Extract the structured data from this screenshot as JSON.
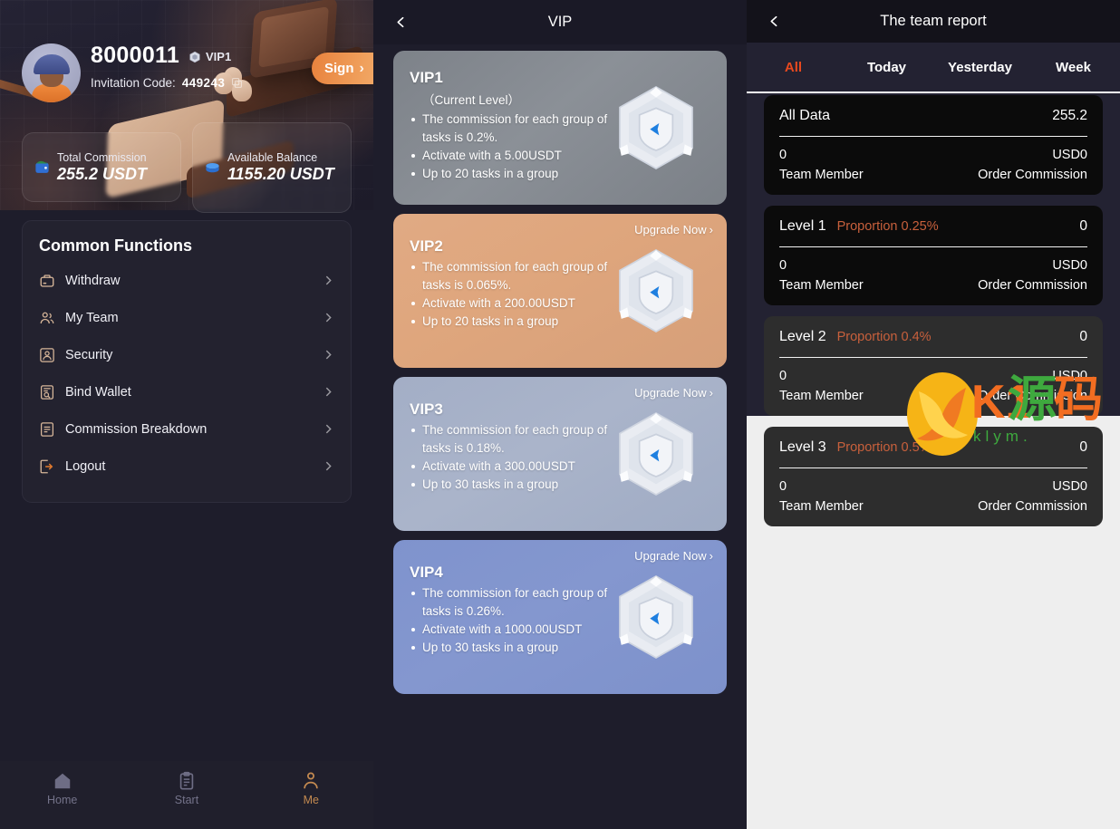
{
  "profile": {
    "uid": "8000011",
    "vip_badge_label": "VIP1",
    "invitation_label": "Invitation Code:",
    "invitation_code": "449243",
    "sign_label": "Sign",
    "sign_chevron": "›",
    "stats": [
      {
        "label": "Total Commission",
        "value": "255.2 USDT",
        "icon": "wallet-icon"
      },
      {
        "label": "Available Balance",
        "value": "1155.20 USDT",
        "icon": "coin-icon"
      }
    ],
    "common_functions": {
      "title": "Common Functions",
      "items": [
        {
          "label": "Withdraw",
          "icon": "withdraw-icon"
        },
        {
          "label": "My Team",
          "icon": "team-icon"
        },
        {
          "label": "Security",
          "icon": "security-icon"
        },
        {
          "label": "Bind Wallet",
          "icon": "bind-wallet-icon"
        },
        {
          "label": "Commission Breakdown",
          "icon": "commission-icon"
        },
        {
          "label": "Logout",
          "icon": "logout-icon"
        }
      ]
    },
    "bottom_nav": [
      {
        "label": "Home",
        "icon": "home-icon",
        "active": false
      },
      {
        "label": "Start",
        "icon": "clipboard-icon",
        "active": false
      },
      {
        "label": "Me",
        "icon": "person-icon",
        "active": true
      }
    ]
  },
  "vip": {
    "header_title": "VIP",
    "back_icon": "chevron-left-icon",
    "upgrade_label": "Upgrade Now",
    "upgrade_chevron": "›",
    "cards": [
      {
        "name": "VIP1",
        "subtitle": "（Current Level）",
        "bullets": [
          "The commission for each group of tasks is 0.2%.",
          "Activate with a 5.00USDT",
          "Up to 20 tasks in a group"
        ],
        "upgrade": false,
        "color": "#82878e"
      },
      {
        "name": "VIP2",
        "subtitle": "",
        "bullets": [
          "The commission for each group of tasks is 0.065%.",
          "Activate with a 200.00USDT",
          "Up to 20 tasks in a group"
        ],
        "upgrade": true,
        "color": "#dda77e"
      },
      {
        "name": "VIP3",
        "subtitle": "",
        "bullets": [
          "The commission for each group of tasks is 0.18%.",
          "Activate with a 300.00USDT",
          "Up to 30 tasks in a group"
        ],
        "upgrade": true,
        "color": "#a5afc6"
      },
      {
        "name": "VIP4",
        "subtitle": "",
        "bullets": [
          "The commission for each group of tasks is 0.26%.",
          "Activate with a 1000.00USDT",
          "Up to 30 tasks in a group"
        ],
        "upgrade": true,
        "color": "#8296ce"
      }
    ]
  },
  "team": {
    "header_title": "The team report",
    "back_icon": "chevron-left-icon",
    "active_tab_color": "#e8491e",
    "tabs": [
      {
        "label": "All",
        "active": true
      },
      {
        "label": "Today",
        "active": false
      },
      {
        "label": "Yesterday",
        "active": false
      },
      {
        "label": "Week",
        "active": false
      }
    ],
    "cards": [
      {
        "title": "All Data",
        "proportion": "",
        "top_value": "255.2",
        "member_count": "0",
        "member_caption": "Team Member",
        "commission_value": "USD0",
        "commission_caption": "Order Commission"
      },
      {
        "title": "Level 1",
        "proportion": "Proportion 0.25%",
        "top_value": "0",
        "member_count": "0",
        "member_caption": "Team Member",
        "commission_value": "USD0",
        "commission_caption": "Order Commission"
      },
      {
        "title": "Level 2",
        "proportion": "Proportion 0.4%",
        "top_value": "0",
        "member_count": "0",
        "member_caption": "Team Member",
        "commission_value": "USD0",
        "commission_caption": "Order Commission"
      },
      {
        "title": "Level 3",
        "proportion": "Proportion 0.5%",
        "top_value": "0",
        "member_count": "0",
        "member_caption": "Team Member",
        "commission_value": "USD0",
        "commission_caption": "Order Commission"
      }
    ]
  },
  "watermark": {
    "brand": "K1",
    "cn1": "源",
    "cn2": "码",
    "url": "klym."
  }
}
